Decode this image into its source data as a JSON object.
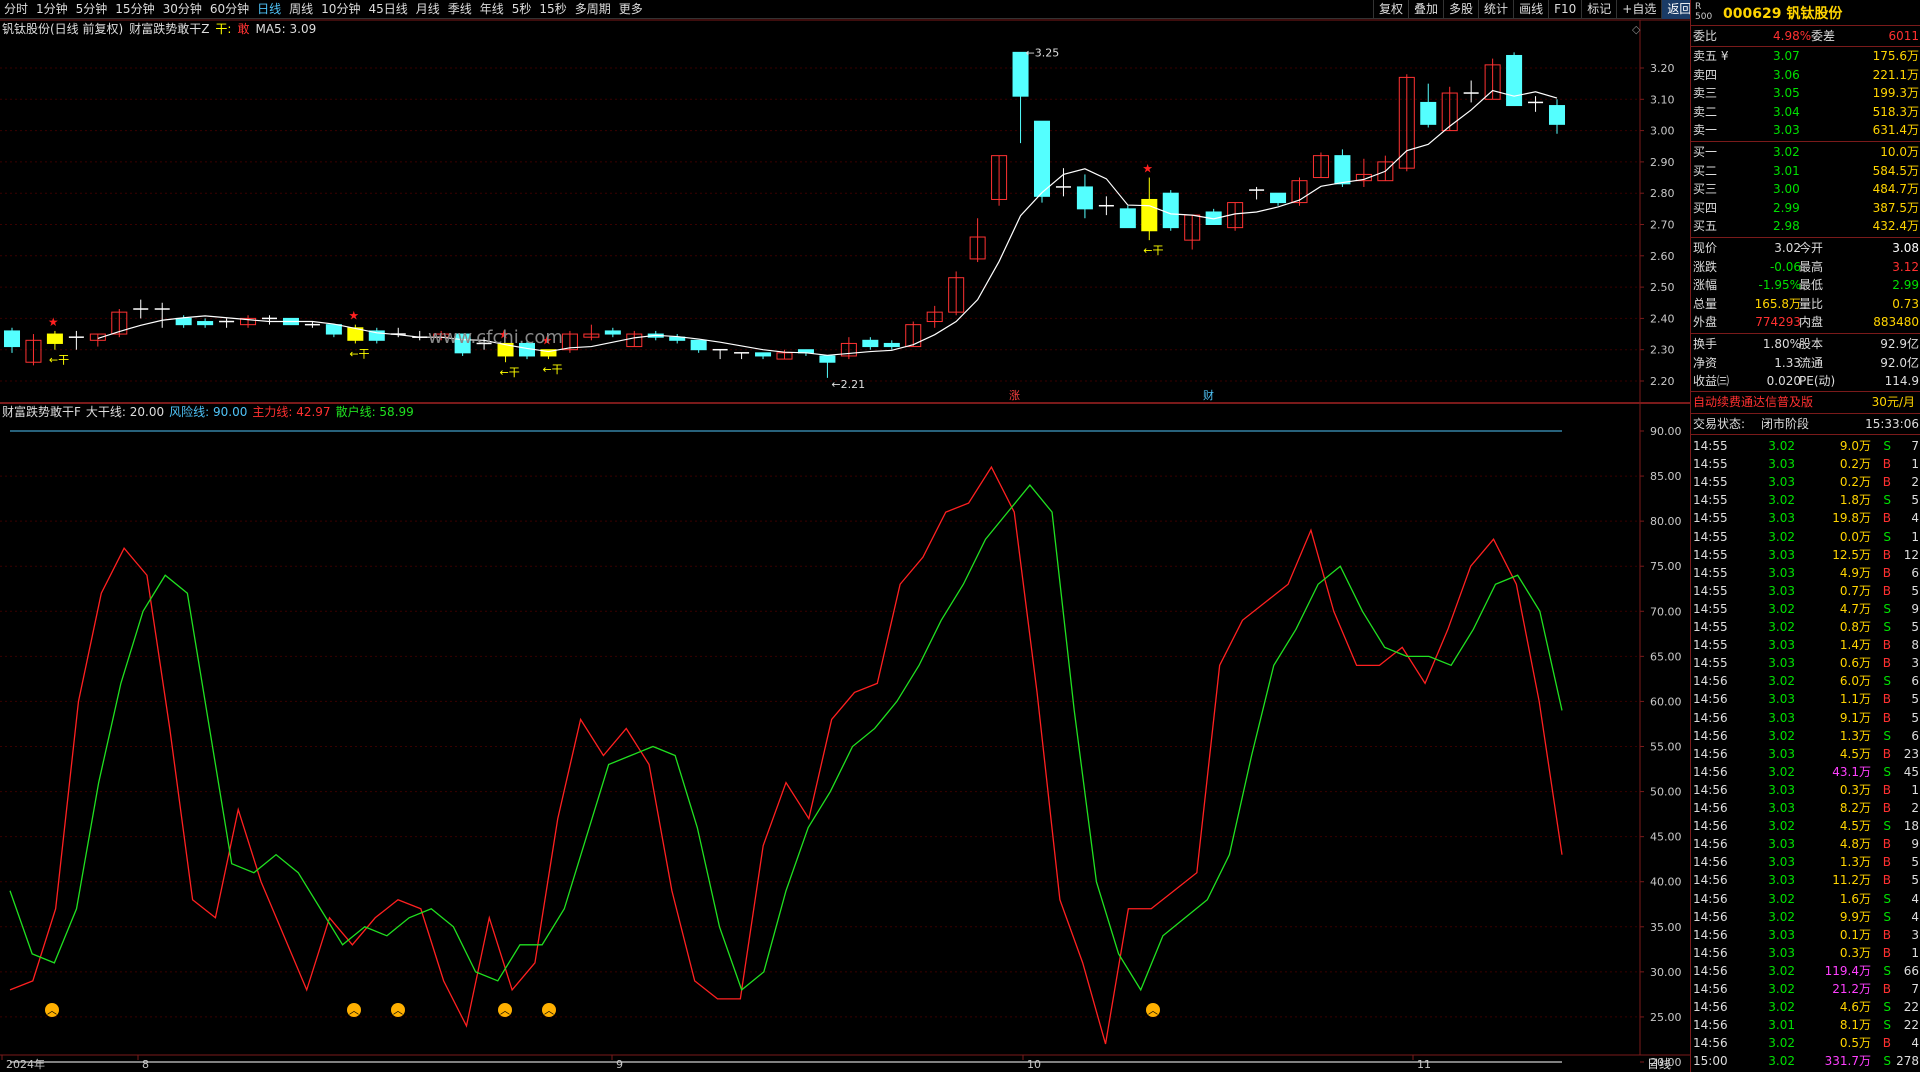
{
  "periods": [
    "分时",
    "1分钟",
    "5分钟",
    "15分钟",
    "30分钟",
    "60分钟",
    "日线",
    "周线",
    "10分钟",
    "45日线",
    "月线",
    "季线",
    "年线",
    "5秒",
    "15秒",
    "多周期",
    "更多"
  ],
  "active_period": "日线",
  "tools": [
    "复权",
    "叠加",
    "多股",
    "统计",
    "画线",
    "F10",
    "标记",
    "+自选",
    "返回"
  ],
  "kline_title": {
    "name": "钒钛股份(日线 前复权)",
    "indicator": "财富跌势敢干Z",
    "mark1": "干:",
    "mark2": "敢",
    "ma": "MA5: 3.09"
  },
  "watermark": "www.cfchi.com",
  "price_axis": [
    "3.20",
    "3.10",
    "3.00",
    "2.90",
    "2.80",
    "2.70",
    "2.60",
    "2.50",
    "2.40",
    "2.30",
    "2.20"
  ],
  "annotations": {
    "high": "3.25",
    "low": "2.21",
    "gan": "干",
    "zhang": "涨",
    "cai": "财"
  },
  "indicator_title": {
    "name": "财富跌势敢干F",
    "line1": "大干线: 20.00",
    "line2": "风险线: 90.00",
    "line3": "主力线: 42.97",
    "line4": "散户线: 58.99"
  },
  "ind_axis": [
    "90.00",
    "85.00",
    "80.00",
    "75.00",
    "70.00",
    "65.00",
    "60.00",
    "55.00",
    "50.00",
    "45.00",
    "40.00",
    "35.00",
    "30.00",
    "25.00",
    "20.00"
  ],
  "date_axis": {
    "labels": [
      "2024年",
      "8",
      "9",
      "10",
      "11"
    ],
    "period": "日线"
  },
  "colors": {
    "up": "#ff3232",
    "down": "#54ffff",
    "yellow": "#ffff00",
    "red_line": "#ff2020",
    "green_line": "#20e020",
    "ma": "#ffffff",
    "border": "#7a1a1a"
  },
  "chart_data": {
    "type": "candlestick",
    "ma5_last": 3.09,
    "candles": [
      {
        "o": 2.36,
        "c": 2.31,
        "h": 2.37,
        "l": 2.29,
        "ind": "down"
      },
      {
        "o": 2.26,
        "c": 2.33,
        "h": 2.35,
        "l": 2.25,
        "ind": "up"
      },
      {
        "o": 2.32,
        "c": 2.35,
        "h": 2.36,
        "l": 2.3,
        "ind": "yellow"
      },
      {
        "o": 2.33,
        "c": 2.34,
        "h": 2.36,
        "l": 2.3,
        "ind": "cross"
      },
      {
        "o": 2.33,
        "c": 2.35,
        "h": 2.35,
        "l": 2.31,
        "ind": "up"
      },
      {
        "o": 2.35,
        "c": 2.42,
        "h": 2.43,
        "l": 2.34,
        "ind": "up"
      },
      {
        "o": 2.43,
        "c": 2.43,
        "h": 2.46,
        "l": 2.4,
        "ind": "cross"
      },
      {
        "o": 2.43,
        "c": 2.43,
        "h": 2.45,
        "l": 2.37,
        "ind": "cross"
      },
      {
        "o": 2.4,
        "c": 2.38,
        "h": 2.41,
        "l": 2.37,
        "ind": "down"
      },
      {
        "o": 2.39,
        "c": 2.38,
        "h": 2.4,
        "l": 2.37,
        "ind": "down"
      },
      {
        "o": 2.39,
        "c": 2.39,
        "h": 2.4,
        "l": 2.37,
        "ind": "cross"
      },
      {
        "o": 2.38,
        "c": 2.4,
        "h": 2.41,
        "l": 2.37,
        "ind": "up"
      },
      {
        "o": 2.4,
        "c": 2.4,
        "h": 2.41,
        "l": 2.38,
        "ind": "cross"
      },
      {
        "o": 2.4,
        "c": 2.38,
        "h": 2.4,
        "l": 2.38,
        "ind": "down"
      },
      {
        "o": 2.38,
        "c": 2.38,
        "h": 2.39,
        "l": 2.37,
        "ind": "cross"
      },
      {
        "o": 2.38,
        "c": 2.35,
        "h": 2.38,
        "l": 2.34,
        "ind": "down"
      },
      {
        "o": 2.37,
        "c": 2.33,
        "h": 2.38,
        "l": 2.32,
        "ind": "yellow"
      },
      {
        "o": 2.36,
        "c": 2.33,
        "h": 2.37,
        "l": 2.32,
        "ind": "down"
      },
      {
        "o": 2.36,
        "c": 2.35,
        "h": 2.37,
        "l": 2.34,
        "ind": "cross"
      },
      {
        "o": 2.35,
        "c": 2.34,
        "h": 2.36,
        "l": 2.33,
        "ind": "cross"
      },
      {
        "o": 2.34,
        "c": 2.35,
        "h": 2.36,
        "l": 2.33,
        "ind": "up"
      },
      {
        "o": 2.35,
        "c": 2.29,
        "h": 2.35,
        "l": 2.28,
        "ind": "down"
      },
      {
        "o": 2.31,
        "c": 2.32,
        "h": 2.34,
        "l": 2.3,
        "ind": "cross"
      },
      {
        "o": 2.32,
        "c": 2.28,
        "h": 2.32,
        "l": 2.26,
        "ind": "yellow"
      },
      {
        "o": 2.32,
        "c": 2.28,
        "h": 2.33,
        "l": 2.27,
        "ind": "down"
      },
      {
        "o": 2.28,
        "c": 2.3,
        "h": 2.3,
        "l": 2.27,
        "ind": "yellow"
      },
      {
        "o": 2.3,
        "c": 2.35,
        "h": 2.36,
        "l": 2.29,
        "ind": "up"
      },
      {
        "o": 2.35,
        "c": 2.34,
        "h": 2.38,
        "l": 2.33,
        "ind": "up"
      },
      {
        "o": 2.36,
        "c": 2.35,
        "h": 2.37,
        "l": 2.34,
        "ind": "down"
      },
      {
        "o": 2.31,
        "c": 2.35,
        "h": 2.36,
        "l": 2.31,
        "ind": "up"
      },
      {
        "o": 2.35,
        "c": 2.34,
        "h": 2.36,
        "l": 2.33,
        "ind": "down"
      },
      {
        "o": 2.34,
        "c": 2.33,
        "h": 2.35,
        "l": 2.32,
        "ind": "down"
      },
      {
        "o": 2.33,
        "c": 2.3,
        "h": 2.33,
        "l": 2.29,
        "ind": "down"
      },
      {
        "o": 2.3,
        "c": 2.3,
        "h": 2.3,
        "l": 2.27,
        "ind": "cross"
      },
      {
        "o": 2.29,
        "c": 2.29,
        "h": 2.29,
        "l": 2.27,
        "ind": "cross"
      },
      {
        "o": 2.29,
        "c": 2.28,
        "h": 2.29,
        "l": 2.27,
        "ind": "down"
      },
      {
        "o": 2.27,
        "c": 2.29,
        "h": 2.3,
        "l": 2.27,
        "ind": "up"
      },
      {
        "o": 2.3,
        "c": 2.29,
        "h": 2.3,
        "l": 2.28,
        "ind": "down"
      },
      {
        "o": 2.28,
        "c": 2.26,
        "h": 2.28,
        "l": 2.21,
        "ind": "down"
      },
      {
        "o": 2.28,
        "c": 2.32,
        "h": 2.34,
        "l": 2.27,
        "ind": "up"
      },
      {
        "o": 2.33,
        "c": 2.31,
        "h": 2.34,
        "l": 2.3,
        "ind": "down"
      },
      {
        "o": 2.32,
        "c": 2.31,
        "h": 2.33,
        "l": 2.3,
        "ind": "down"
      },
      {
        "o": 2.31,
        "c": 2.38,
        "h": 2.39,
        "l": 2.31,
        "ind": "up"
      },
      {
        "o": 2.39,
        "c": 2.42,
        "h": 2.44,
        "l": 2.37,
        "ind": "up"
      },
      {
        "o": 2.42,
        "c": 2.53,
        "h": 2.55,
        "l": 2.41,
        "ind": "up"
      },
      {
        "o": 2.59,
        "c": 2.66,
        "h": 2.72,
        "l": 2.58,
        "ind": "up"
      },
      {
        "o": 2.78,
        "c": 2.92,
        "h": 2.92,
        "l": 2.76,
        "ind": "up"
      },
      {
        "o": 3.25,
        "c": 3.11,
        "h": 3.25,
        "l": 2.96,
        "ind": "down"
      },
      {
        "o": 3.03,
        "c": 2.79,
        "h": 3.03,
        "l": 2.77,
        "ind": "down"
      },
      {
        "o": 2.82,
        "c": 2.82,
        "h": 2.88,
        "l": 2.79,
        "ind": "cross"
      },
      {
        "o": 2.82,
        "c": 2.75,
        "h": 2.86,
        "l": 2.72,
        "ind": "down"
      },
      {
        "o": 2.76,
        "c": 2.76,
        "h": 2.79,
        "l": 2.73,
        "ind": "cross"
      },
      {
        "o": 2.75,
        "c": 2.69,
        "h": 2.76,
        "l": 2.69,
        "ind": "down"
      },
      {
        "o": 2.68,
        "c": 2.78,
        "h": 2.85,
        "l": 2.65,
        "ind": "yellow"
      },
      {
        "o": 2.8,
        "c": 2.69,
        "h": 2.81,
        "l": 2.68,
        "ind": "down"
      },
      {
        "o": 2.65,
        "c": 2.73,
        "h": 2.73,
        "l": 2.62,
        "ind": "up"
      },
      {
        "o": 2.74,
        "c": 2.7,
        "h": 2.75,
        "l": 2.7,
        "ind": "down"
      },
      {
        "o": 2.69,
        "c": 2.77,
        "h": 2.77,
        "l": 2.68,
        "ind": "up"
      },
      {
        "o": 2.81,
        "c": 2.81,
        "h": 2.82,
        "l": 2.78,
        "ind": "cross"
      },
      {
        "o": 2.8,
        "c": 2.77,
        "h": 2.8,
        "l": 2.76,
        "ind": "down"
      },
      {
        "o": 2.77,
        "c": 2.84,
        "h": 2.85,
        "l": 2.76,
        "ind": "up"
      },
      {
        "o": 2.85,
        "c": 2.92,
        "h": 2.93,
        "l": 2.85,
        "ind": "up"
      },
      {
        "o": 2.92,
        "c": 2.83,
        "h": 2.94,
        "l": 2.82,
        "ind": "down"
      },
      {
        "o": 2.84,
        "c": 2.86,
        "h": 2.91,
        "l": 2.82,
        "ind": "up"
      },
      {
        "o": 2.84,
        "c": 2.9,
        "h": 2.92,
        "l": 2.84,
        "ind": "up"
      },
      {
        "o": 2.88,
        "c": 3.17,
        "h": 3.18,
        "l": 2.87,
        "ind": "up"
      },
      {
        "o": 3.09,
        "c": 3.02,
        "h": 3.15,
        "l": 3.01,
        "ind": "down"
      },
      {
        "o": 3.0,
        "c": 3.12,
        "h": 3.14,
        "l": 3.0,
        "ind": "up"
      },
      {
        "o": 3.12,
        "c": 3.12,
        "h": 3.16,
        "l": 3.09,
        "ind": "cross"
      },
      {
        "o": 3.1,
        "c": 3.21,
        "h": 3.23,
        "l": 3.1,
        "ind": "up"
      },
      {
        "o": 3.24,
        "c": 3.08,
        "h": 3.25,
        "l": 3.08,
        "ind": "down"
      },
      {
        "o": 3.09,
        "c": 3.09,
        "h": 3.11,
        "l": 3.06,
        "ind": "cross"
      },
      {
        "o": 3.08,
        "c": 3.02,
        "h": 3.1,
        "l": 2.99,
        "ind": "down"
      }
    ],
    "red_line": [
      28,
      29,
      37,
      60,
      72,
      77,
      74,
      57,
      38,
      36,
      48,
      40,
      34,
      28,
      36,
      33,
      36,
      38,
      37,
      29,
      24,
      36,
      28,
      31,
      47,
      58,
      54,
      57,
      53,
      39,
      29,
      27,
      27,
      44,
      51,
      47,
      58,
      61,
      62,
      73,
      76,
      81,
      82,
      86,
      81,
      61,
      38,
      31,
      22,
      37,
      37,
      39,
      41,
      64,
      69,
      71,
      73,
      79,
      70,
      64,
      64,
      66,
      62,
      68,
      75,
      78,
      73,
      60,
      43
    ],
    "green_line": [
      39,
      32,
      31,
      37,
      51,
      62,
      70,
      74,
      72,
      57,
      42,
      41,
      43,
      41,
      37,
      33,
      35,
      34,
      36,
      37,
      35,
      30,
      29,
      33,
      33,
      37,
      45,
      53,
      54,
      55,
      54,
      46,
      35,
      28,
      30,
      39,
      46,
      50,
      55,
      57,
      60,
      64,
      69,
      73,
      78,
      81,
      84,
      81,
      59,
      40,
      32,
      28,
      34,
      36,
      38,
      43,
      54,
      64,
      68,
      73,
      75,
      70,
      66,
      65,
      65,
      64,
      68,
      73,
      74,
      70,
      59
    ],
    "markers": [
      1,
      9,
      10,
      12,
      13,
      28
    ]
  },
  "quote": {
    "code": "000629",
    "name": "钒钛股份",
    "badge_r": "R",
    "badge_num": "500",
    "weibi_label": "委比",
    "weibi": "4.98%",
    "weicha_label": "委差",
    "weicha": "6011",
    "asks": [
      [
        "卖五",
        "3.07",
        "175.6万"
      ],
      [
        "卖四",
        "3.06",
        "221.1万"
      ],
      [
        "卖三",
        "3.05",
        "199.3万"
      ],
      [
        "卖二",
        "3.04",
        "518.3万"
      ],
      [
        "卖一",
        "3.03",
        "631.4万"
      ]
    ],
    "yen": "¥",
    "bids": [
      [
        "买一",
        "3.02",
        "10.0万"
      ],
      [
        "买二",
        "3.01",
        "584.5万"
      ],
      [
        "买三",
        "3.00",
        "484.7万"
      ],
      [
        "买四",
        "2.99",
        "387.5万"
      ],
      [
        "买五",
        "2.98",
        "432.4万"
      ]
    ],
    "stats": [
      [
        "现价",
        "3.02",
        "今开",
        "3.08"
      ],
      [
        "涨跌",
        "-0.06",
        "最高",
        "3.12"
      ],
      [
        "涨幅",
        "-1.95%",
        "最低",
        "2.99"
      ],
      [
        "总量",
        "165.8万",
        "量比",
        "0.73"
      ],
      [
        "外盘",
        "774293",
        "内盘",
        "883480"
      ]
    ],
    "stats2": [
      [
        "换手",
        "1.80%",
        "股本",
        "92.9亿"
      ],
      [
        "净资",
        "1.33",
        "流通",
        "92.0亿"
      ],
      [
        "收益㈢",
        "0.020",
        "PE(动)",
        "114.9"
      ]
    ],
    "promo": "自动续费通达信普及版",
    "price": "30元/月",
    "status_label": "交易状态:",
    "status": "闭市阶段",
    "time": "15:33:06"
  },
  "trades": [
    [
      "14:55",
      "3.02",
      "9.0万",
      "S",
      "7"
    ],
    [
      "14:55",
      "3.03",
      "0.2万",
      "B",
      "1"
    ],
    [
      "14:55",
      "3.03",
      "0.2万",
      "B",
      "2"
    ],
    [
      "14:55",
      "3.02",
      "1.8万",
      "S",
      "5"
    ],
    [
      "14:55",
      "3.03",
      "19.8万",
      "B",
      "4"
    ],
    [
      "14:55",
      "3.02",
      "0.0万",
      "S",
      "1"
    ],
    [
      "14:55",
      "3.03",
      "12.5万",
      "B",
      "12"
    ],
    [
      "14:55",
      "3.03",
      "4.9万",
      "B",
      "6"
    ],
    [
      "14:55",
      "3.03",
      "0.7万",
      "B",
      "5"
    ],
    [
      "14:55",
      "3.02",
      "4.7万",
      "S",
      "9"
    ],
    [
      "14:55",
      "3.02",
      "0.8万",
      "S",
      "5"
    ],
    [
      "14:55",
      "3.03",
      "1.4万",
      "B",
      "8"
    ],
    [
      "14:55",
      "3.03",
      "0.6万",
      "B",
      "3"
    ],
    [
      "14:56",
      "3.02",
      "6.0万",
      "S",
      "6"
    ],
    [
      "14:56",
      "3.03",
      "1.1万",
      "B",
      "5"
    ],
    [
      "14:56",
      "3.03",
      "9.1万",
      "B",
      "5"
    ],
    [
      "14:56",
      "3.02",
      "1.3万",
      "S",
      "6"
    ],
    [
      "14:56",
      "3.03",
      "4.5万",
      "B",
      "23"
    ],
    [
      "14:56",
      "3.02",
      "43.1万",
      "S",
      "45"
    ],
    [
      "14:56",
      "3.03",
      "0.3万",
      "B",
      "1"
    ],
    [
      "14:56",
      "3.03",
      "8.2万",
      "B",
      "2"
    ],
    [
      "14:56",
      "3.02",
      "4.5万",
      "S",
      "18"
    ],
    [
      "14:56",
      "3.03",
      "4.8万",
      "B",
      "9"
    ],
    [
      "14:56",
      "3.03",
      "1.3万",
      "B",
      "5"
    ],
    [
      "14:56",
      "3.03",
      "11.2万",
      "B",
      "5"
    ],
    [
      "14:56",
      "3.02",
      "1.6万",
      "S",
      "4"
    ],
    [
      "14:56",
      "3.02",
      "9.9万",
      "S",
      "4"
    ],
    [
      "14:56",
      "3.03",
      "0.1万",
      "B",
      "3"
    ],
    [
      "14:56",
      "3.03",
      "0.3万",
      "B",
      "1"
    ],
    [
      "14:56",
      "3.02",
      "119.4万",
      "S",
      "66"
    ],
    [
      "14:56",
      "3.02",
      "21.2万",
      "B",
      "7"
    ],
    [
      "14:56",
      "3.02",
      "4.6万",
      "S",
      "22"
    ],
    [
      "14:56",
      "3.01",
      "8.1万",
      "S",
      "22"
    ],
    [
      "14:56",
      "3.02",
      "0.5万",
      "B",
      "4"
    ],
    [
      "15:00",
      "3.02",
      "331.7万",
      "S",
      "278"
    ]
  ]
}
